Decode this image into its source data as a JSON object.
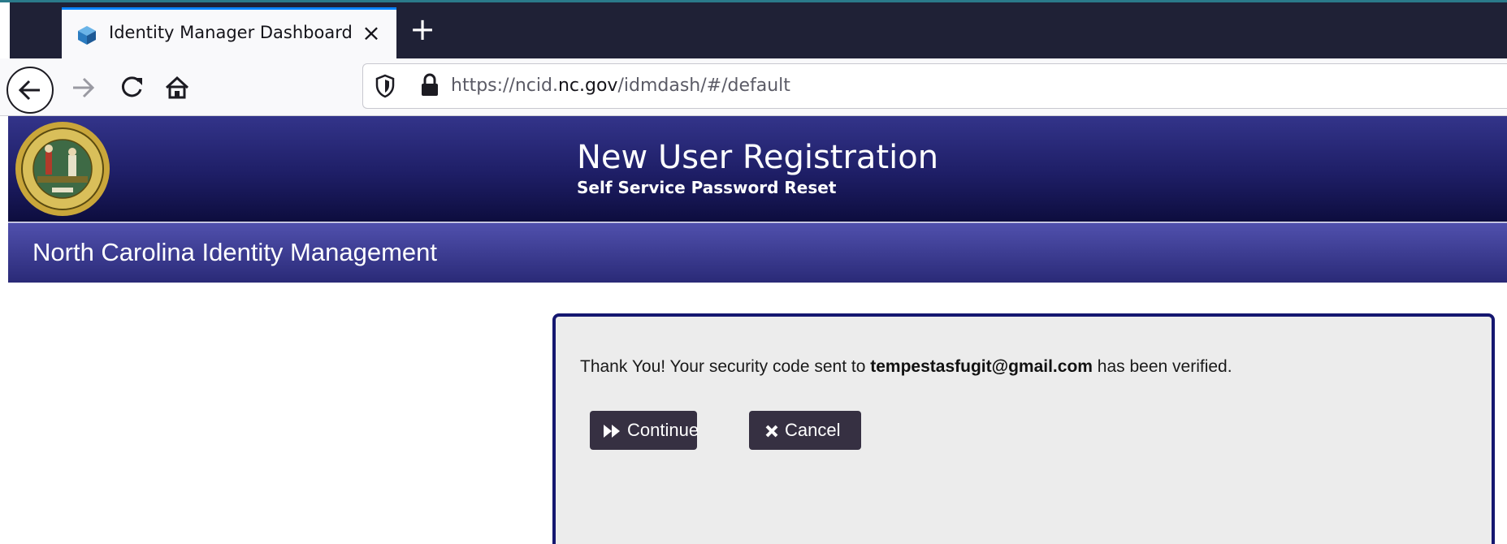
{
  "browser": {
    "tab": {
      "title": "Identity Manager Dashboard",
      "close_glyph": "×",
      "favicon": "netiq-cube-icon"
    },
    "new_tab_glyph": "+",
    "address_bar": {
      "url_prefix": "https://ncid.",
      "url_domain": "nc.gov",
      "url_suffix": "/idmdash/#/default"
    }
  },
  "header": {
    "title": "New User Registration",
    "subtitle": "Self Service Password Reset",
    "banner": "North Carolina Identity Management",
    "seal": "nc-state-seal-icon"
  },
  "panel": {
    "message_before": "Thank You! Your security code sent to ",
    "email": "tempestasfugit@gmail.com",
    "message_after": " has been verified.",
    "continue_label": "Continue",
    "cancel_label": "Cancel"
  },
  "colors": {
    "header_dark": "#0d0d3e",
    "header_light": "#33348a",
    "panel_border": "#151770",
    "button_bg": "#363042",
    "tab_accent": "#0a84ff"
  }
}
